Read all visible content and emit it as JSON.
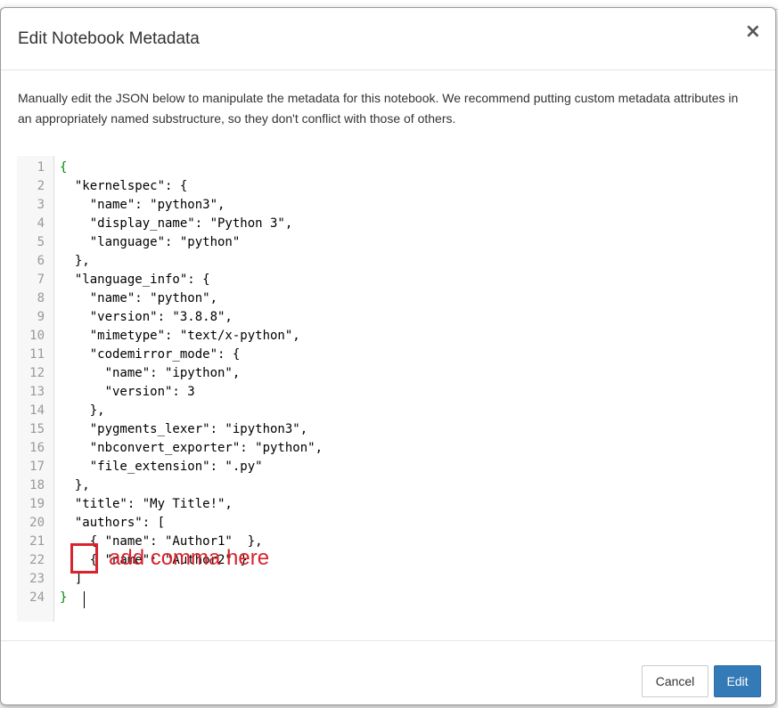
{
  "dialog": {
    "title": "Edit Notebook Metadata",
    "close_symbol": "×",
    "intro": "Manually edit the JSON below to manipulate the metadata for this notebook. We recommend putting custom metadata attributes in an appropriately named substructure, so they don't conflict with those of others."
  },
  "editor": {
    "lines": [
      {
        "num": "1",
        "text": "{"
      },
      {
        "num": "2",
        "text": "  \"kernelspec\": {"
      },
      {
        "num": "3",
        "text": "    \"name\": \"python3\","
      },
      {
        "num": "4",
        "text": "    \"display_name\": \"Python 3\","
      },
      {
        "num": "5",
        "text": "    \"language\": \"python\""
      },
      {
        "num": "6",
        "text": "  },"
      },
      {
        "num": "7",
        "text": "  \"language_info\": {"
      },
      {
        "num": "8",
        "text": "    \"name\": \"python\","
      },
      {
        "num": "9",
        "text": "    \"version\": \"3.8.8\","
      },
      {
        "num": "10",
        "text": "    \"mimetype\": \"text/x-python\","
      },
      {
        "num": "11",
        "text": "    \"codemirror_mode\": {"
      },
      {
        "num": "12",
        "text": "      \"name\": \"ipython\","
      },
      {
        "num": "13",
        "text": "      \"version\": 3"
      },
      {
        "num": "14",
        "text": "    },"
      },
      {
        "num": "15",
        "text": "    \"pygments_lexer\": \"ipython3\","
      },
      {
        "num": "16",
        "text": "    \"nbconvert_exporter\": \"python\","
      },
      {
        "num": "17",
        "text": "    \"file_extension\": \".py\""
      },
      {
        "num": "18",
        "text": "  },"
      },
      {
        "num": "19",
        "text": "  \"title\": \"My Title!\","
      },
      {
        "num": "20",
        "text": "  \"authors\": ["
      },
      {
        "num": "21",
        "text": "    { \"name\": \"Author1\"  },"
      },
      {
        "num": "22",
        "text": "    { \"name\": \"Author2\" }"
      },
      {
        "num": "23",
        "text": "  ]"
      },
      {
        "num": "24",
        "text": "}"
      }
    ]
  },
  "annotation": {
    "text": "add comma here",
    "color": "#d9232d"
  },
  "footer": {
    "cancel_label": "Cancel",
    "edit_label": "Edit"
  },
  "colors": {
    "primary": "#337ab7",
    "bracket": "#008800"
  }
}
